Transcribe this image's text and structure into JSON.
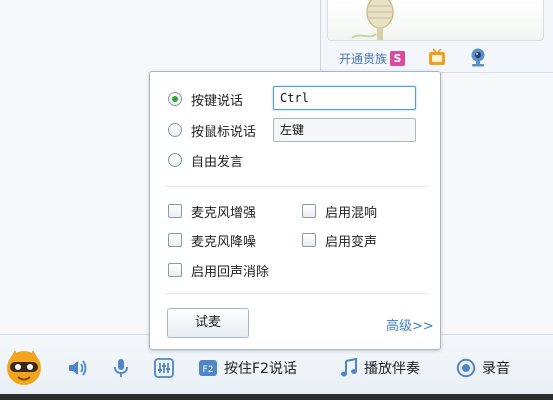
{
  "profile_panel": {
    "vip_label": "开通贵族",
    "vip_badge": "S"
  },
  "voice_popup": {
    "modes": [
      {
        "label": "按键说话",
        "checked": true,
        "field_value": "Ctrl"
      },
      {
        "label": "按鼠标说话",
        "checked": false,
        "field_value": "左键"
      },
      {
        "label": "自由发言",
        "checked": false
      }
    ],
    "options_left": [
      "麦克风增强",
      "麦克风降噪",
      "启用回声消除"
    ],
    "options_right": [
      "启用混响",
      "启用变声"
    ],
    "test_button": "试麦",
    "advanced_link": "高级>>"
  },
  "toolbar": {
    "push_to_talk_key": "F2",
    "push_to_talk_label": "按住F2说话",
    "accompaniment_label": "播放伴奏",
    "record_label": "录音"
  },
  "colors": {
    "accent_link": "#3d7fc1",
    "radio_checked": "#2fa52f",
    "vip_badge": "#d94aa0",
    "tv_icon": "#f0a020"
  }
}
